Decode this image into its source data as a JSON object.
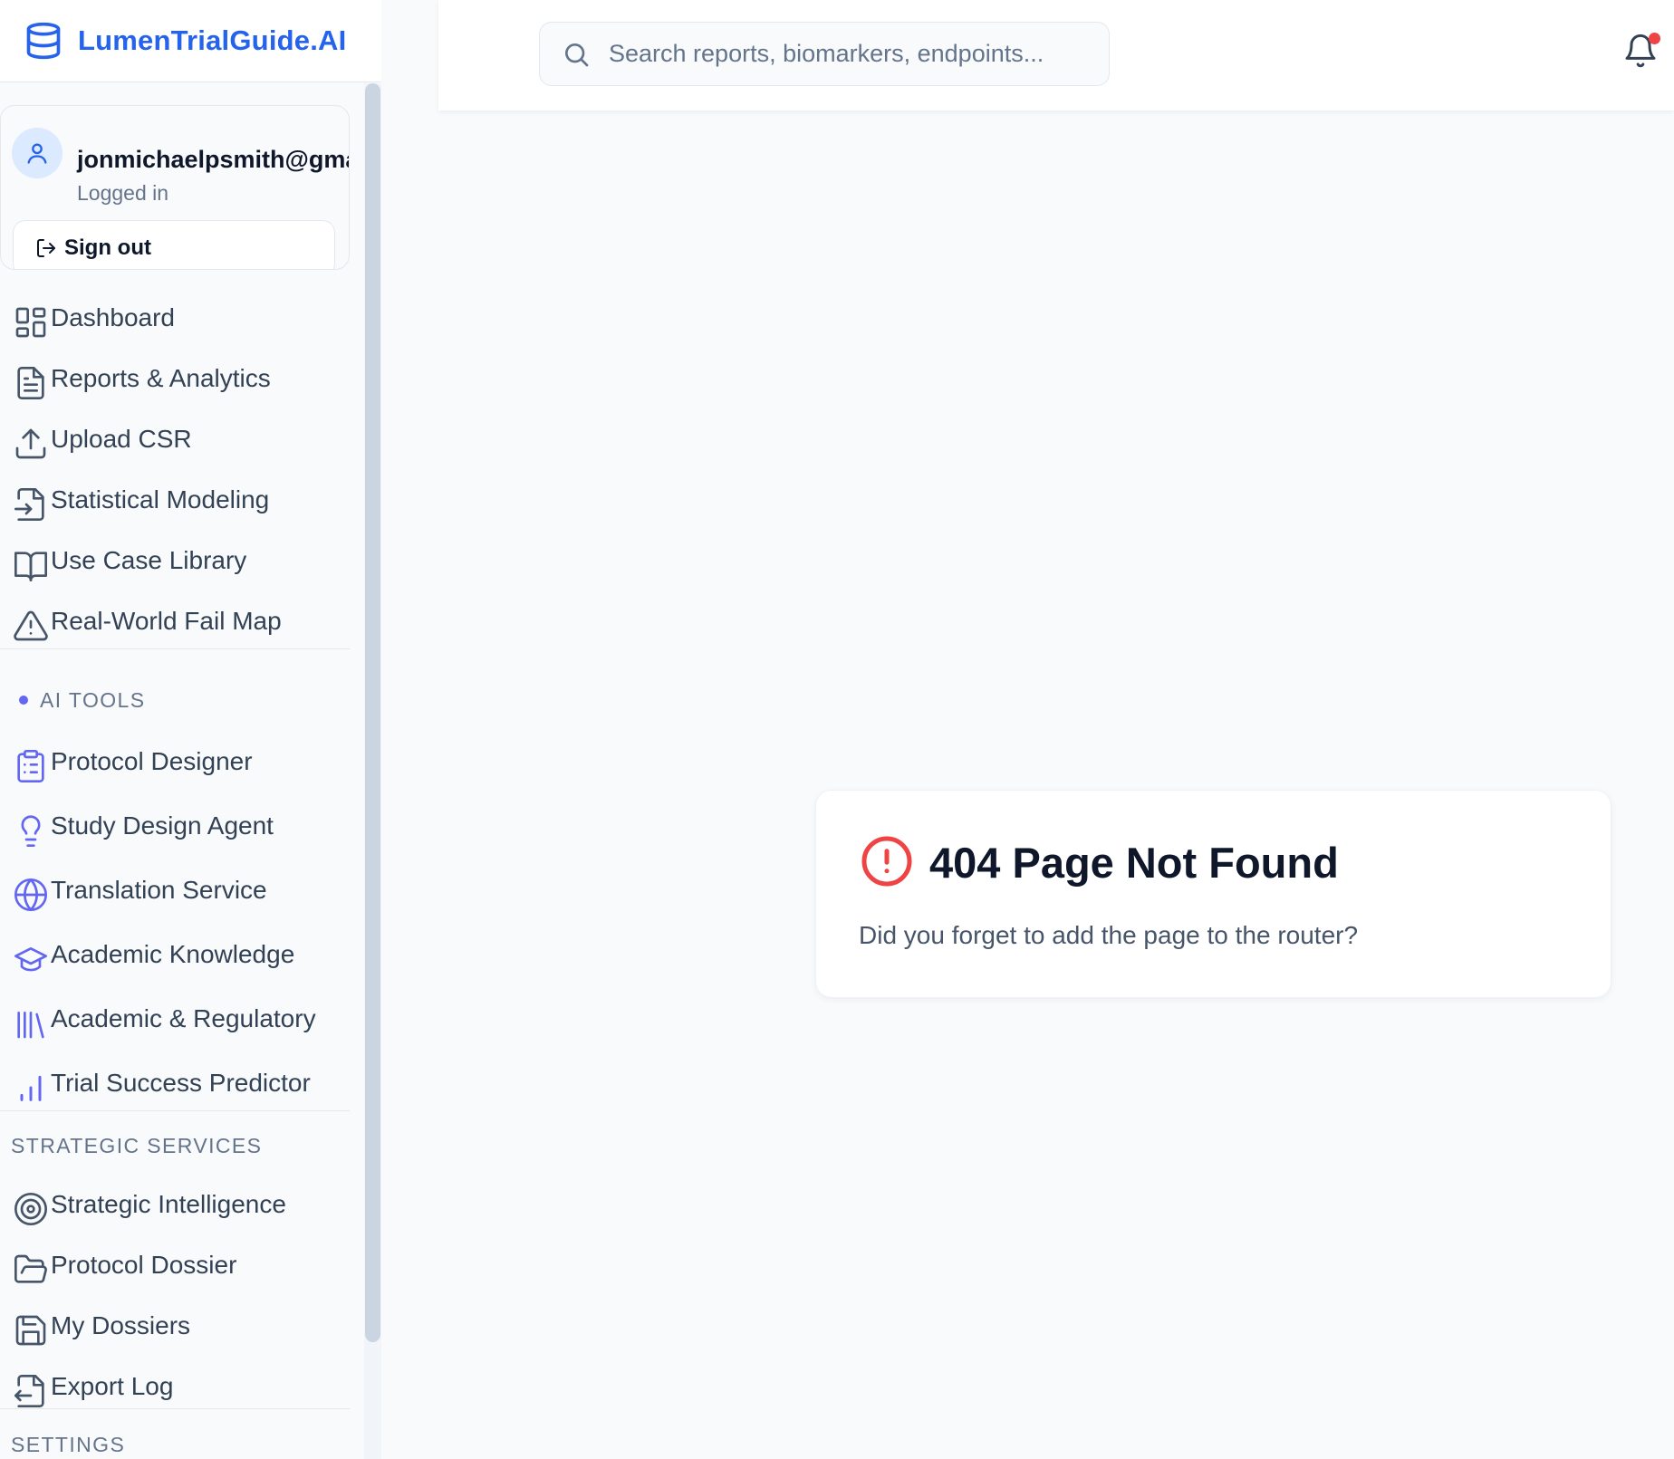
{
  "app": {
    "brand_name": "LumenTrialGuide.AI",
    "icon": "database-icon",
    "brand_color": "#2563eb"
  },
  "user": {
    "email": "jonmichaelpsmith@gmail",
    "status": "Logged in",
    "sign_out_label": "Sign out"
  },
  "nav": {
    "main": [
      {
        "label": "Dashboard",
        "icon": "layout-grid-icon"
      },
      {
        "label": "Reports & Analytics",
        "icon": "file-text-icon"
      },
      {
        "label": "Upload CSR",
        "icon": "upload-icon"
      },
      {
        "label": "Statistical Modeling",
        "icon": "file-input-icon"
      },
      {
        "label": "Use Case Library",
        "icon": "book-open-icon"
      },
      {
        "label": "Real-World Fail Map",
        "icon": "alert-triangle-icon"
      }
    ],
    "ai_tools_label": "AI TOOLS",
    "ai_tools": [
      {
        "label": "Protocol Designer",
        "icon": "clipboard-list-icon"
      },
      {
        "label": "Study Design Agent",
        "icon": "lightbulb-icon"
      },
      {
        "label": "Translation Service",
        "icon": "globe-icon"
      },
      {
        "label": "Academic Knowledge",
        "icon": "graduation-cap-icon"
      },
      {
        "label": "Academic & Regulatory",
        "icon": "library-icon"
      },
      {
        "label": "Trial Success Predictor",
        "icon": "bar-chart-icon"
      }
    ],
    "strategic_label": "STRATEGIC SERVICES",
    "strategic": [
      {
        "label": "Strategic Intelligence",
        "icon": "target-icon"
      },
      {
        "label": "Protocol Dossier",
        "icon": "folder-open-icon"
      },
      {
        "label": "My Dossiers",
        "icon": "save-icon"
      },
      {
        "label": "Export Log",
        "icon": "file-export-icon"
      }
    ],
    "settings_label": "SETTINGS"
  },
  "header": {
    "search_placeholder": "Search reports, biomarkers, endpoints...",
    "notification_icon": "bell-icon",
    "notification_dot_color": "#ef4444"
  },
  "error": {
    "title": "404 Page Not Found",
    "message": "Did you forget to add the page to the router?",
    "icon": "alert-circle-icon",
    "icon_color": "#ef4444"
  }
}
